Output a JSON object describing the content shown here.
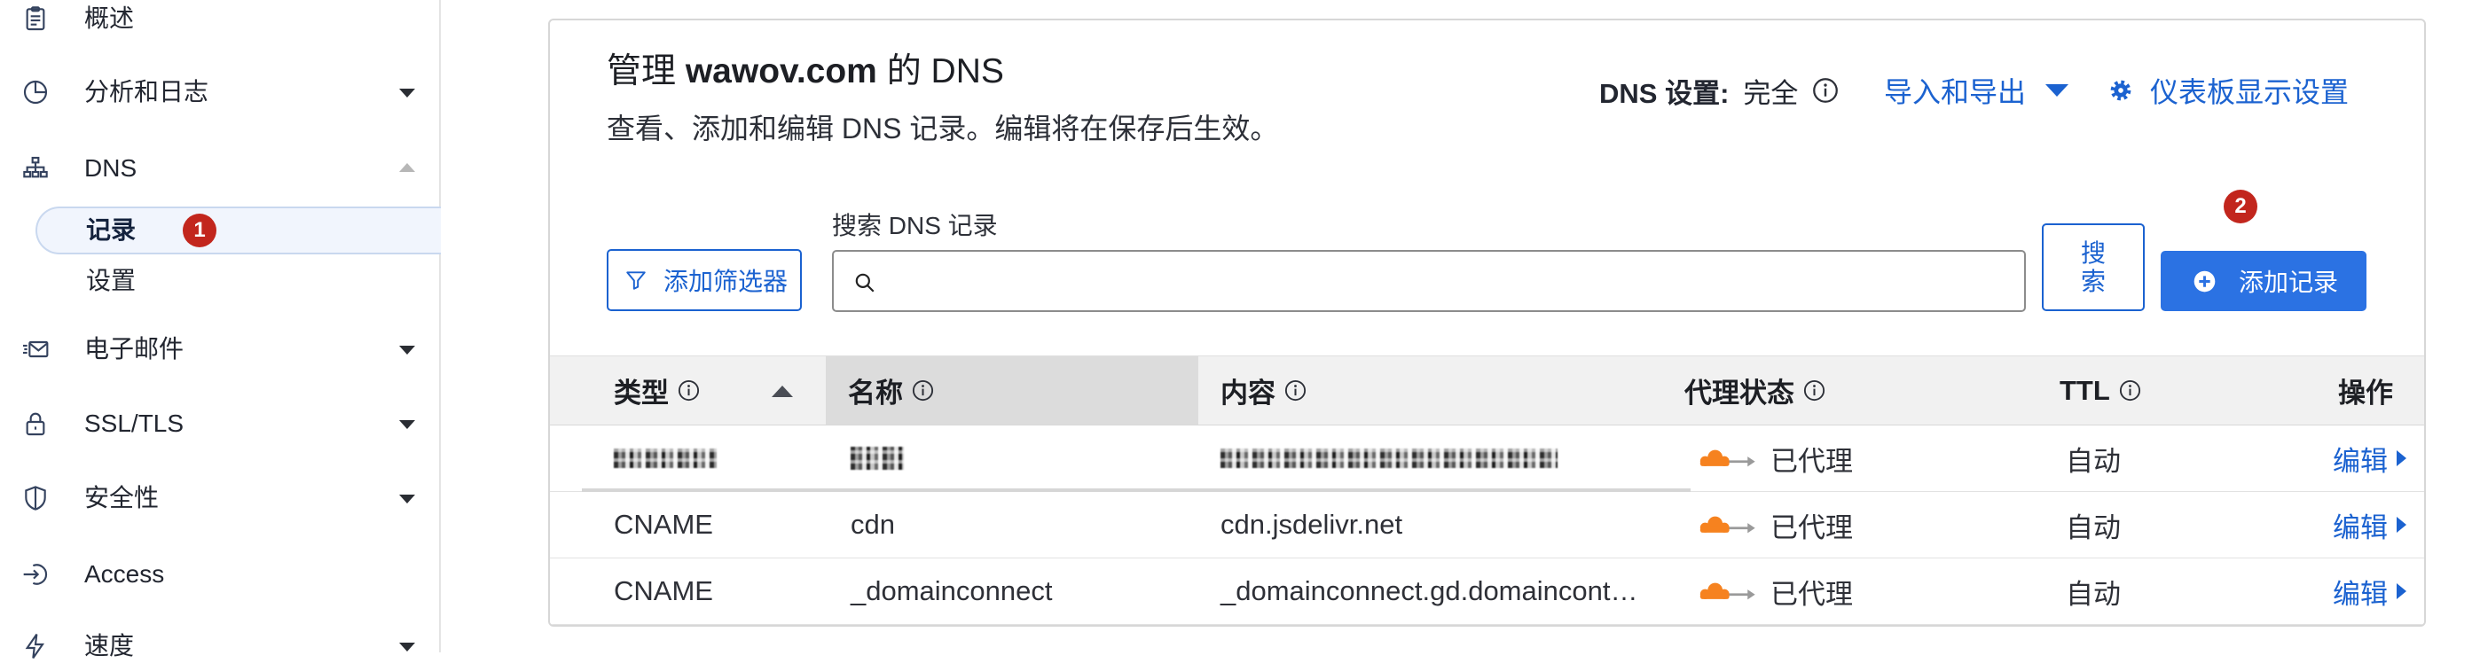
{
  "sidebar": {
    "items": [
      {
        "label": "概述",
        "icon": "clipboard-icon"
      },
      {
        "label": "分析和日志",
        "icon": "pie-chart-icon",
        "expandable": true
      },
      {
        "label": "DNS",
        "icon": "sitemap-icon",
        "expandable": true,
        "expanded": true,
        "children": [
          {
            "label": "记录",
            "active": true,
            "badge": "1"
          },
          {
            "label": "设置"
          }
        ]
      },
      {
        "label": "电子邮件",
        "icon": "mail-icon",
        "expandable": true
      },
      {
        "label": "SSL/TLS",
        "icon": "lock-icon",
        "expandable": true
      },
      {
        "label": "安全性",
        "icon": "shield-icon",
        "expandable": true
      },
      {
        "label": "Access",
        "icon": "access-icon"
      },
      {
        "label": "速度",
        "icon": "lightning-icon",
        "expandable": true
      }
    ]
  },
  "header": {
    "title_prefix": "管理 ",
    "title_domain": "wawov.com",
    "title_suffix": " 的 DNS",
    "subtitle": "查看、添加和编辑 DNS 记录。编辑将在保存后生效。",
    "dns_setting_label": "DNS 设置:",
    "dns_setting_value": "完全",
    "import_export": "导入和导出",
    "dashboard_settings": "仪表板显示设置"
  },
  "toolbar": {
    "filter_button": "添加筛选器",
    "search_label": "搜索 DNS 记录",
    "search_button": "搜索",
    "add_record_button": "添加记录",
    "badge": "2"
  },
  "table": {
    "columns": [
      "类型",
      "名称",
      "内容",
      "代理状态",
      "TTL",
      "操作"
    ],
    "sort_icon": "sort-up-icon",
    "rows": [
      {
        "redacted": true,
        "proxy": "已代理",
        "ttl": "自动",
        "action": "编辑"
      },
      {
        "type": "CNAME",
        "name": "cdn",
        "content": "cdn.jsdelivr.net",
        "proxy": "已代理",
        "ttl": "自动",
        "action": "编辑"
      },
      {
        "type": "CNAME",
        "name": "_domainconnect",
        "content": "_domainconnect.gd.domaincont…",
        "proxy": "已代理",
        "ttl": "自动",
        "action": "编辑"
      }
    ]
  },
  "colors": {
    "link": "#1b62d0",
    "primary": "#2b72e3",
    "badge": "#c2261d",
    "cloud": "#f6821f"
  }
}
